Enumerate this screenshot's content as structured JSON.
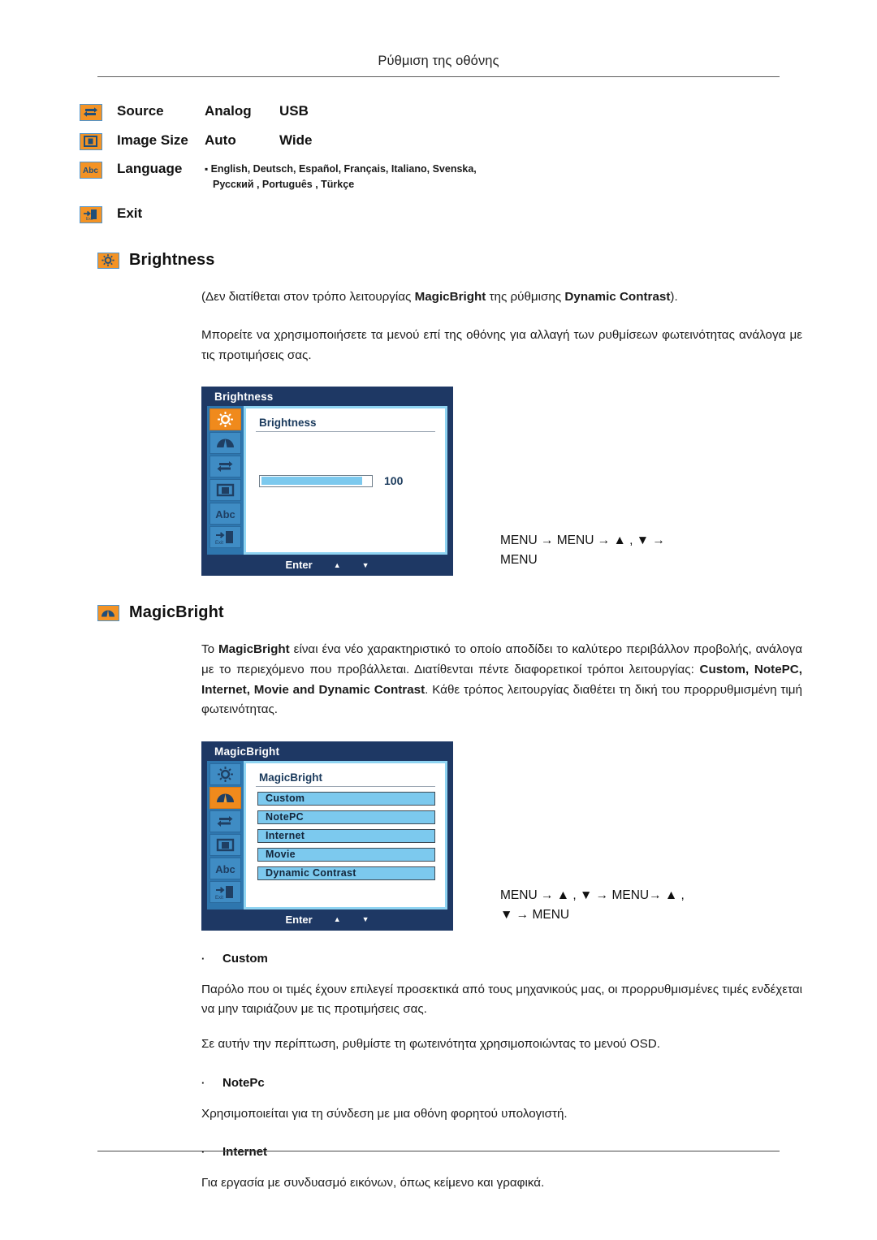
{
  "header": {
    "title": "Ρύθμιση της οθόνης"
  },
  "legend": {
    "rows": [
      {
        "icon": "source-icon",
        "label": "Source",
        "value1": "Analog",
        "value2": "USB"
      },
      {
        "icon": "image-size-icon",
        "label": "Image Size",
        "value1": "Auto",
        "value2": "Wide"
      },
      {
        "icon": "language-icon",
        "label": "Language",
        "languages_line1": "English, Deutsch, Español, Français,  Italiano, Svenska,",
        "languages_line2": "Русский , Português , Türkçe"
      },
      {
        "icon": "exit-icon",
        "label": "Exit"
      }
    ]
  },
  "brightness": {
    "icon": "brightness-icon",
    "heading": "Brightness",
    "note": "(Δεν διατίθεται στον τρόπο λειτουργίας MagicBright της ρύθμισης Dynamic Contrast).",
    "note_bold_1": "MagicBright",
    "note_bold_2": "Dynamic Contrast",
    "paragraph": "Μπορείτε να χρησιμοποιήσετε τα μενού επί της οθόνης για αλλαγή των ρυθμίσεων φωτεινότητας ανάλογα με τις προτιμήσεις σας.",
    "osd": {
      "title": "Brightness",
      "panel_title": "Brightness",
      "value": "100",
      "fill_percent": 92,
      "footer": {
        "enter": "Enter",
        "up": "▲",
        "down": "▼"
      },
      "sidebar_icons": [
        "brightness-icon",
        "magicbright-icon",
        "source-icon",
        "image-size-icon",
        "language-icon",
        "exit-icon"
      ],
      "active_index": 0
    },
    "keyseq_line1": "MENU  →  MENU  →  ▲ ,  ▼ →",
    "keyseq_line2": "MENU"
  },
  "magicbright": {
    "icon": "magicbright-icon",
    "heading": "MagicBright",
    "paragraph": "Το MagicBright είναι ένα νέο χαρακτηριστικό το οποίο αποδίδει το καλύτερο περιβάλλον προβολής, ανάλογα με το περιεχόμενο που προβάλλεται. Διατίθενται πέντε διαφορετικοί τρόποι λειτουργίας: Custom, NotePC, Internet, Movie and Dynamic Contrast. Κάθε τρόπος λειτουργίας διαθέτει τη δική του προρρυθμισμένη τιμή φωτεινότητας.",
    "osd": {
      "title": "MagicBright",
      "panel_title": "MagicBright",
      "items": [
        "Custom",
        "NotePC",
        "Internet",
        "Movie",
        "Dynamic Contrast"
      ],
      "footer": {
        "enter": "Enter",
        "up": "▲",
        "down": "▼"
      },
      "sidebar_icons": [
        "brightness-icon",
        "magicbright-icon",
        "source-icon",
        "image-size-icon",
        "language-icon",
        "exit-icon"
      ],
      "active_index": 1
    },
    "keyseq_line1": "MENU → ▲ , ▼ → MENU→ ▲ ,",
    "keyseq_line2": "▼ → MENU",
    "modes": [
      {
        "name": "Custom",
        "paragraph1": "Παρόλο που οι τιμές έχουν επιλεγεί προσεκτικά από τους μηχανικούς μας, οι προρρυθμισμένες τιμές ενδέχεται να μην ταιριάζουν με τις προτιμήσεις σας.",
        "paragraph2": "Σε αυτήν την περίπτωση, ρυθμίστε τη φωτεινότητα χρησιμοποιώντας το μενού OSD."
      },
      {
        "name": "NotePc",
        "paragraph1": "Χρησιμοποιείται για τη σύνδεση με μια οθόνη φορητού υπολογιστή."
      },
      {
        "name": "Internet",
        "paragraph1": "Για εργασία με συνδυασμό εικόνων, όπως κείμενο και γραφικά."
      }
    ]
  },
  "colors": {
    "icon_orange": "#f39325",
    "icon_border_blue": "#4f94cd",
    "osd_navy": "#1e3864",
    "osd_sidebar_blue": "#2e76ae",
    "osd_item_blue": "#3f8cc4",
    "osd_active_orange": "#f08a1c",
    "osd_accent_lightblue": "#7cc9ee",
    "osd_panel_border": "#8fd4f2"
  },
  "bullet_char": "·"
}
